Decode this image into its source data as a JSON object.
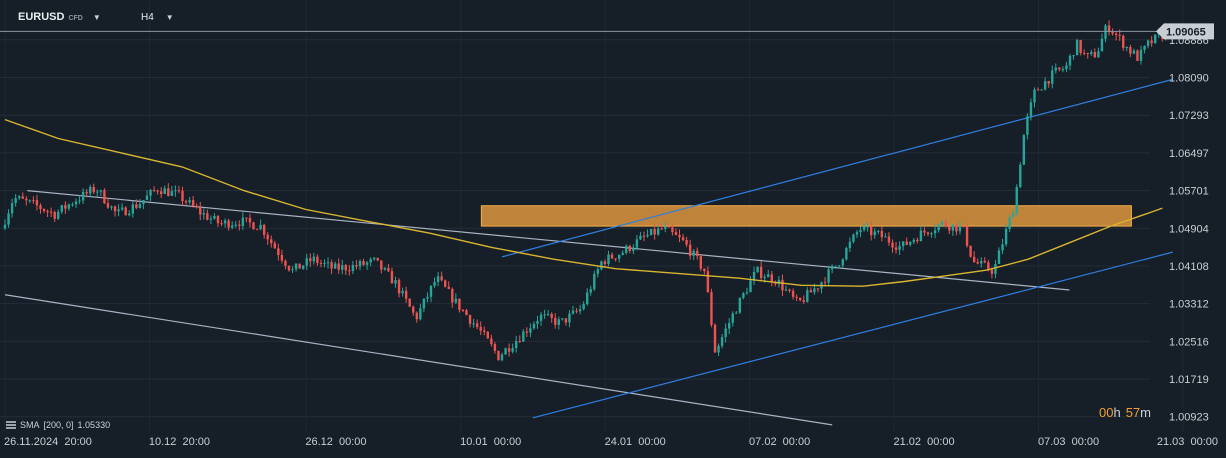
{
  "toolbar": {
    "symbol": "EURUSD",
    "symbol_kind": "CFD",
    "timeframe": "H4"
  },
  "indicator": {
    "label": "SMA",
    "params": "[200,  0]",
    "value": "1.05330"
  },
  "countdown": {
    "hours": "00",
    "hours_unit": "h",
    "minutes": "57",
    "minutes_unit": "m"
  },
  "colors": {
    "background": "#161e27",
    "bull_candle": "#26a69a",
    "bear_candle": "#ef5350",
    "sma": "#d8b530",
    "blue_trend": "#2f7fe0",
    "gray_trend": "#a8b4c4",
    "zone_fill": "#f0a040",
    "price_label": "#c9ced4"
  },
  "chart_data": {
    "type": "candlestick",
    "symbol": "EURUSD",
    "timeframe": "H4",
    "x_axis": {
      "type": "date",
      "range": [
        "2024-11-26 20:00",
        "2025-03-21 00:00"
      ],
      "tick_labels": [
        "26.11.2024  20:00",
        "10.12  20:00",
        "26.12  00:00",
        "10.01  00:00",
        "24.01  00:00",
        "07.02  00:00",
        "21.02  00:00",
        "07.03  00:00",
        "21.03  00:00"
      ]
    },
    "y_axis": {
      "range": [
        1.006,
        1.096
      ],
      "tick_labels": [
        "1.08886",
        "1.08090",
        "1.07293",
        "1.06497",
        "1.05701",
        "1.04904",
        "1.04108",
        "1.03312",
        "1.02516",
        "1.01719",
        "1.00923"
      ],
      "tick_values": [
        1.08886,
        1.0809,
        1.07293,
        1.06497,
        1.05701,
        1.04904,
        1.04108,
        1.03312,
        1.02516,
        1.01719,
        1.00923
      ]
    },
    "grid": true,
    "current_price": {
      "label": "1.09065",
      "value": 1.09065
    },
    "price_path": [
      [
        "2024-11-26 20:00",
        1.049
      ],
      [
        "2024-11-28 00:00",
        1.0555
      ],
      [
        "2024-11-30 00:00",
        1.054
      ],
      [
        "2024-12-02 00:00",
        1.052
      ],
      [
        "2024-12-04 00:00",
        1.055
      ],
      [
        "2024-12-06 00:00",
        1.0575
      ],
      [
        "2024-12-08 00:00",
        1.052
      ],
      [
        "2024-12-10 00:00",
        1.054
      ],
      [
        "2024-12-12 00:00",
        1.0575
      ],
      [
        "2024-12-14 00:00",
        1.056
      ],
      [
        "2024-12-16 00:00",
        1.0525
      ],
      [
        "2024-12-18 00:00",
        1.05
      ],
      [
        "2024-12-20 00:00",
        1.0505
      ],
      [
        "2024-12-22 00:00",
        1.0495
      ],
      [
        "2024-12-23 00:00",
        1.046
      ],
      [
        "2024-12-25 00:00",
        1.04
      ],
      [
        "2024-12-27 00:00",
        1.0425
      ],
      [
        "2024-12-29 00:00",
        1.0405
      ],
      [
        "2024-12-31 00:00",
        1.041
      ],
      [
        "2025-01-02 00:00",
        1.042
      ],
      [
        "2025-01-04 00:00",
        1.0375
      ],
      [
        "2025-01-06 00:00",
        1.03
      ],
      [
        "2025-01-08 00:00",
        1.0385
      ],
      [
        "2025-01-10 00:00",
        1.033
      ],
      [
        "2025-01-12 00:00",
        1.028
      ],
      [
        "2025-01-14 00:00",
        1.022
      ],
      [
        "2025-01-16 00:00",
        1.026
      ],
      [
        "2025-01-18 00:00",
        1.0305
      ],
      [
        "2025-01-20 00:00",
        1.029
      ],
      [
        "2025-01-22 00:00",
        1.032
      ],
      [
        "2025-01-24 00:00",
        1.042
      ],
      [
        "2025-01-26 00:00",
        1.044
      ],
      [
        "2025-01-28 00:00",
        1.047
      ],
      [
        "2025-01-30 00:00",
        1.049
      ],
      [
        "2025-02-01 00:00",
        1.046
      ],
      [
        "2025-02-03 00:00",
        1.04
      ],
      [
        "2025-02-04 00:00",
        1.023
      ],
      [
        "2025-02-06 00:00",
        1.032
      ],
      [
        "2025-02-08 00:00",
        1.04
      ],
      [
        "2025-02-10 00:00",
        1.038
      ],
      [
        "2025-02-12 00:00",
        1.033
      ],
      [
        "2025-02-14 00:00",
        1.037
      ],
      [
        "2025-02-16 00:00",
        1.042
      ],
      [
        "2025-02-18 00:00",
        1.049
      ],
      [
        "2025-02-20 00:00",
        1.0475
      ],
      [
        "2025-02-22 00:00",
        1.045
      ],
      [
        "2025-02-24 00:00",
        1.048
      ],
      [
        "2025-02-26 00:00",
        1.05
      ],
      [
        "2025-02-28 00:00",
        1.049
      ],
      [
        "2025-03-01 00:00",
        1.042
      ],
      [
        "2025-03-03 00:00",
        1.04
      ],
      [
        "2025-03-04 00:00",
        1.047
      ],
      [
        "2025-03-05 00:00",
        1.054
      ],
      [
        "2025-03-06 00:00",
        1.07
      ],
      [
        "2025-03-07 00:00",
        1.078
      ],
      [
        "2025-03-09 00:00",
        1.082
      ],
      [
        "2025-03-10 00:00",
        1.083
      ],
      [
        "2025-03-11 00:00",
        1.088
      ],
      [
        "2025-03-12 00:00",
        1.085
      ],
      [
        "2025-03-13 00:00",
        1.086
      ],
      [
        "2025-03-14 00:00",
        1.092
      ],
      [
        "2025-03-15 00:00",
        1.0895
      ],
      [
        "2025-03-16 00:00",
        1.087
      ],
      [
        "2025-03-17 00:00",
        1.085
      ],
      [
        "2025-03-18 00:00",
        1.088
      ],
      [
        "2025-03-19 00:00",
        1.0895
      ],
      [
        "2025-03-20 00:00",
        1.0906
      ]
    ],
    "sma_200": [
      [
        "2024-11-26 20:00",
        1.072
      ],
      [
        "2024-12-02 00:00",
        1.068
      ],
      [
        "2024-12-08 00:00",
        1.065
      ],
      [
        "2024-12-14 00:00",
        1.062
      ],
      [
        "2024-12-20 00:00",
        1.057
      ],
      [
        "2024-12-26 00:00",
        1.053
      ],
      [
        "2025-01-01 00:00",
        1.0505
      ],
      [
        "2025-01-07 00:00",
        1.048
      ],
      [
        "2025-01-13 00:00",
        1.045
      ],
      [
        "2025-01-19 00:00",
        1.0425
      ],
      [
        "2025-01-25 00:00",
        1.0405
      ],
      [
        "2025-01-31 00:00",
        1.0395
      ],
      [
        "2025-02-06 00:00",
        1.0385
      ],
      [
        "2025-02-12 00:00",
        1.037
      ],
      [
        "2025-02-18 00:00",
        1.0368
      ],
      [
        "2025-02-22 00:00",
        1.0378
      ],
      [
        "2025-02-26 00:00",
        1.039
      ],
      [
        "2025-03-02 00:00",
        1.0402
      ],
      [
        "2025-03-06 00:00",
        1.0425
      ],
      [
        "2025-03-10 00:00",
        1.046
      ],
      [
        "2025-03-14 00:00",
        1.0495
      ],
      [
        "2025-03-18 00:00",
        1.0525
      ],
      [
        "2025-03-19 00:00",
        1.0533
      ]
    ],
    "trend_lines": [
      {
        "color": "#a8b4c4",
        "from": [
          "2024-11-29 00:00",
          1.057
        ],
        "to": [
          "2025-03-10 00:00",
          1.036
        ]
      },
      {
        "color": "#a8b4c4",
        "from": [
          "2024-11-26 20:00",
          1.035
        ],
        "to": [
          "2025-02-15 00:00",
          1.0075
        ]
      },
      {
        "color": "#2f7fe0",
        "from": [
          "2025-01-14 00:00",
          1.043
        ],
        "to": [
          "2025-03-20 00:00",
          1.0805
        ]
      },
      {
        "color": "#2f7fe0",
        "from": [
          "2025-01-17 00:00",
          1.009
        ],
        "to": [
          "2025-03-20 00:00",
          1.044
        ]
      }
    ],
    "zone": {
      "from": "2025-01-12 00:00",
      "to": "2025-03-16 00:00",
      "y_low": 1.0495,
      "y_high": 1.0538
    }
  }
}
